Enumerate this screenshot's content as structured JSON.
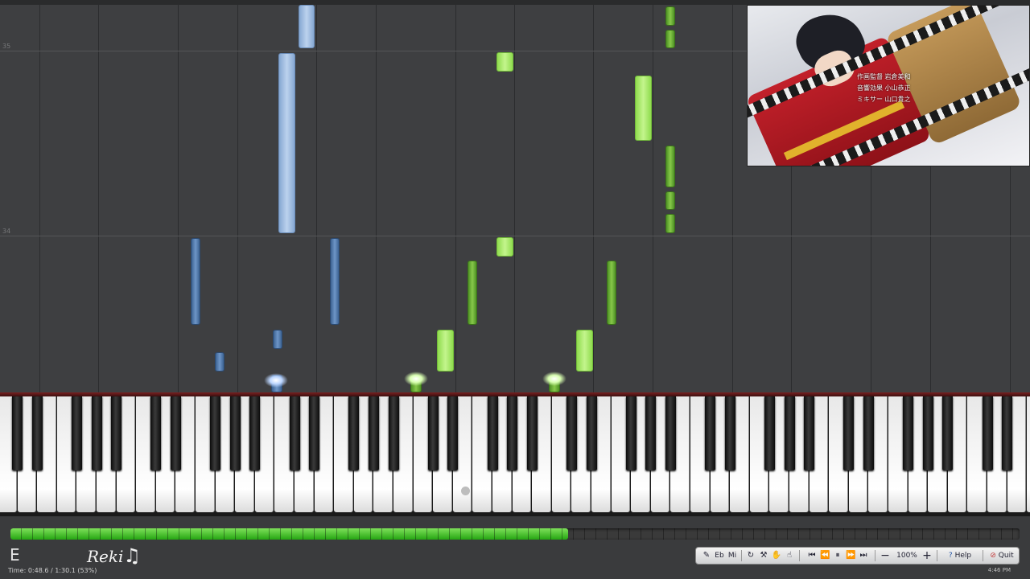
{
  "roll": {
    "measure_numbers": [
      "35",
      "34"
    ]
  },
  "status": {
    "key_label": "E",
    "time_text": "Time: 0:48.6 / 1:30.1 (53%)",
    "clock": "4:46 PM"
  },
  "playback": {
    "progress_fraction": 0.553
  },
  "logo": {
    "text": "Reki",
    "glyph": "♫"
  },
  "video": {
    "credit_lines": [
      "作画監督  岩倉美和",
      "音響効果  小山恭正",
      "ミキサー  山口貴之"
    ]
  },
  "toolbar": {
    "track_icon": "microphone-icon",
    "btn_e": "Eb",
    "btn_mi": "Mi",
    "zoom_value": "100%",
    "help_label": "Help",
    "quit_label": "Quit"
  },
  "colors": {
    "left_hand": "#6e96c7",
    "right_hand": "#87c84a",
    "progress": "#25a612",
    "background": "#3e3f41"
  }
}
